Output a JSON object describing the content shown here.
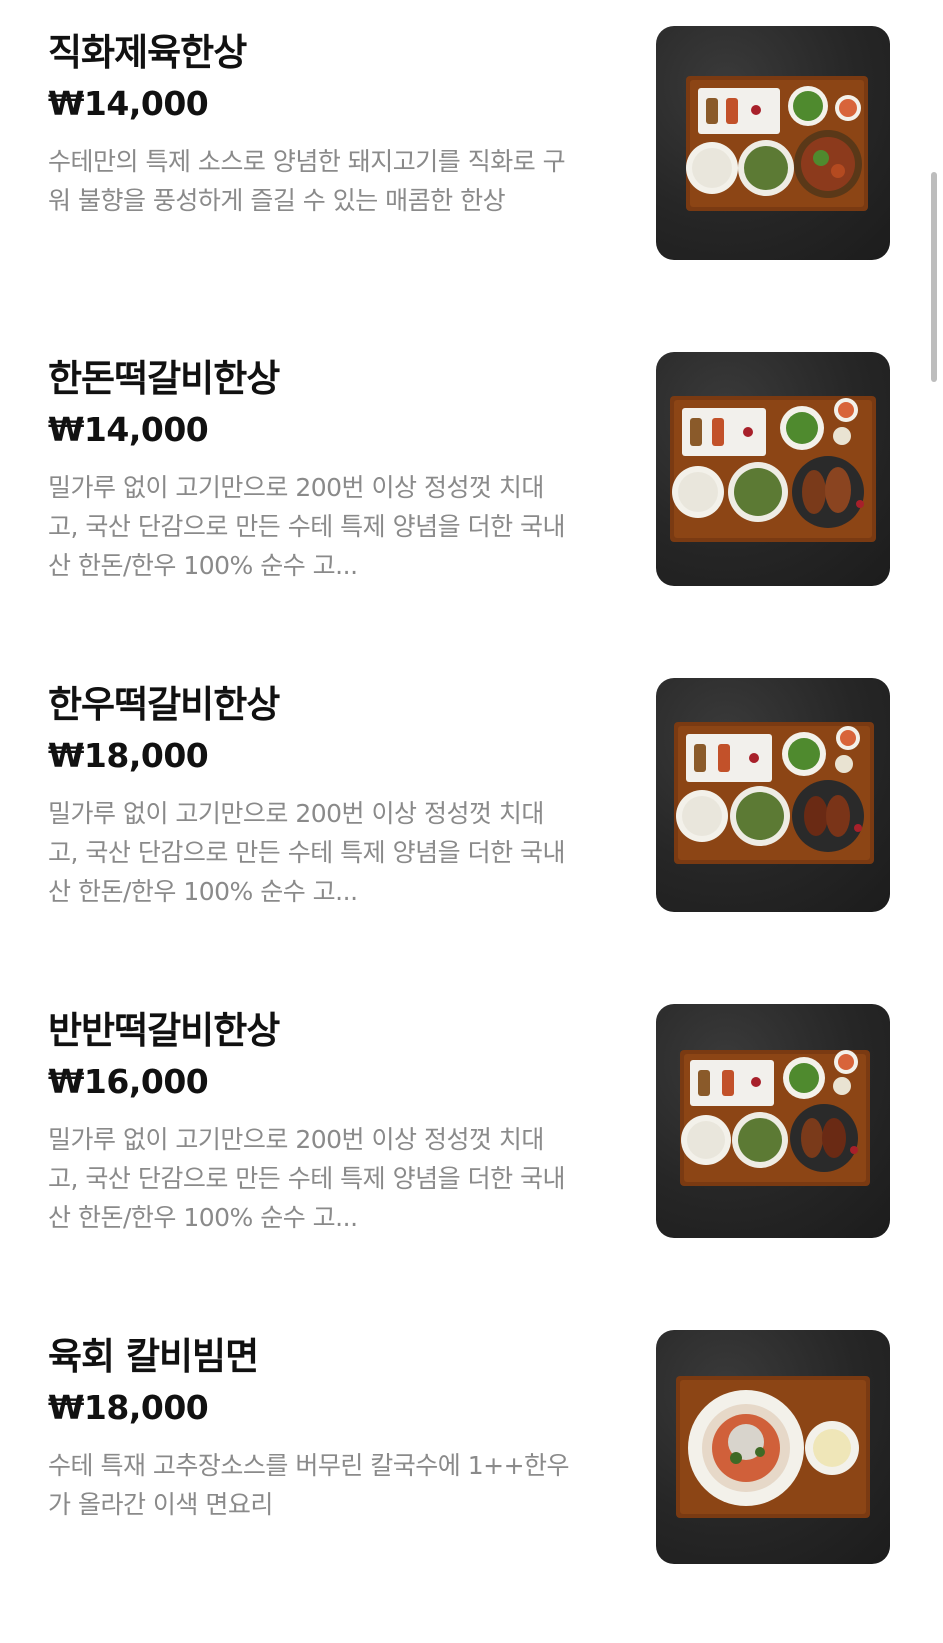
{
  "items": [
    {
      "name": "직화제육한상",
      "price": "₩14,000",
      "description": "수테만의 특제 소스로 양념한 돼지고기를 직화로 구워 불향을 풍성하게 즐길 수 있는 매콤한 한상",
      "photo_icon": "jeyuk-tray-photo"
    },
    {
      "name": "한돈떡갈비한상",
      "price": "₩14,000",
      "description": "밀가루 없이 고기만으로 200번 이상 정성껏 치대고, 국산 단감으로 만든 수테 특제 양념을 더한 국내산 한돈/한우 100% 순수 고...",
      "photo_icon": "tteokgalbi-tray-photo"
    },
    {
      "name": "한우떡갈비한상",
      "price": "₩18,000",
      "description": "밀가루 없이 고기만으로 200번 이상 정성껏 치대고, 국산 단감으로 만든 수테 특제 양념을 더한 국내산 한돈/한우 100% 순수 고...",
      "photo_icon": "tteokgalbi-tray-photo"
    },
    {
      "name": "반반떡갈비한상",
      "price": "₩16,000",
      "description": "밀가루 없이 고기만으로 200번 이상 정성껏 치대고, 국산 단감으로 만든 수테 특제 양념을 더한 국내산 한돈/한우 100% 순수 고...",
      "photo_icon": "tteokgalbi-tray-photo"
    },
    {
      "name": "육회 칼비빔면",
      "price": "₩18,000",
      "description": "수테 특재 고추장소스를 버무린 칼국수에 1++한우가 올라간 이색 면요리",
      "photo_icon": "noodle-tray-photo"
    }
  ]
}
